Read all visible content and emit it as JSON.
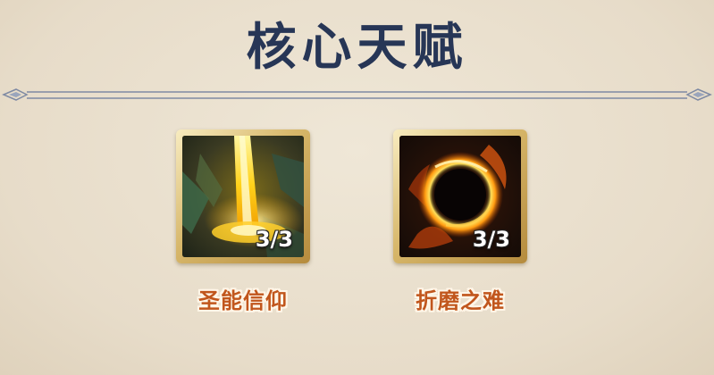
{
  "panel": {
    "title": "核心天赋"
  },
  "talents": [
    {
      "name": "圣能信仰",
      "rank_text": "3/3",
      "icon": "holy-light-beam-icon"
    },
    {
      "name": "折磨之难",
      "rank_text": "3/3",
      "icon": "fire-ring-icon"
    }
  ],
  "colors": {
    "title": "#273656",
    "label": "#c1561c",
    "frame_gold": "#d7b76a",
    "background": "#e9e0cf"
  }
}
